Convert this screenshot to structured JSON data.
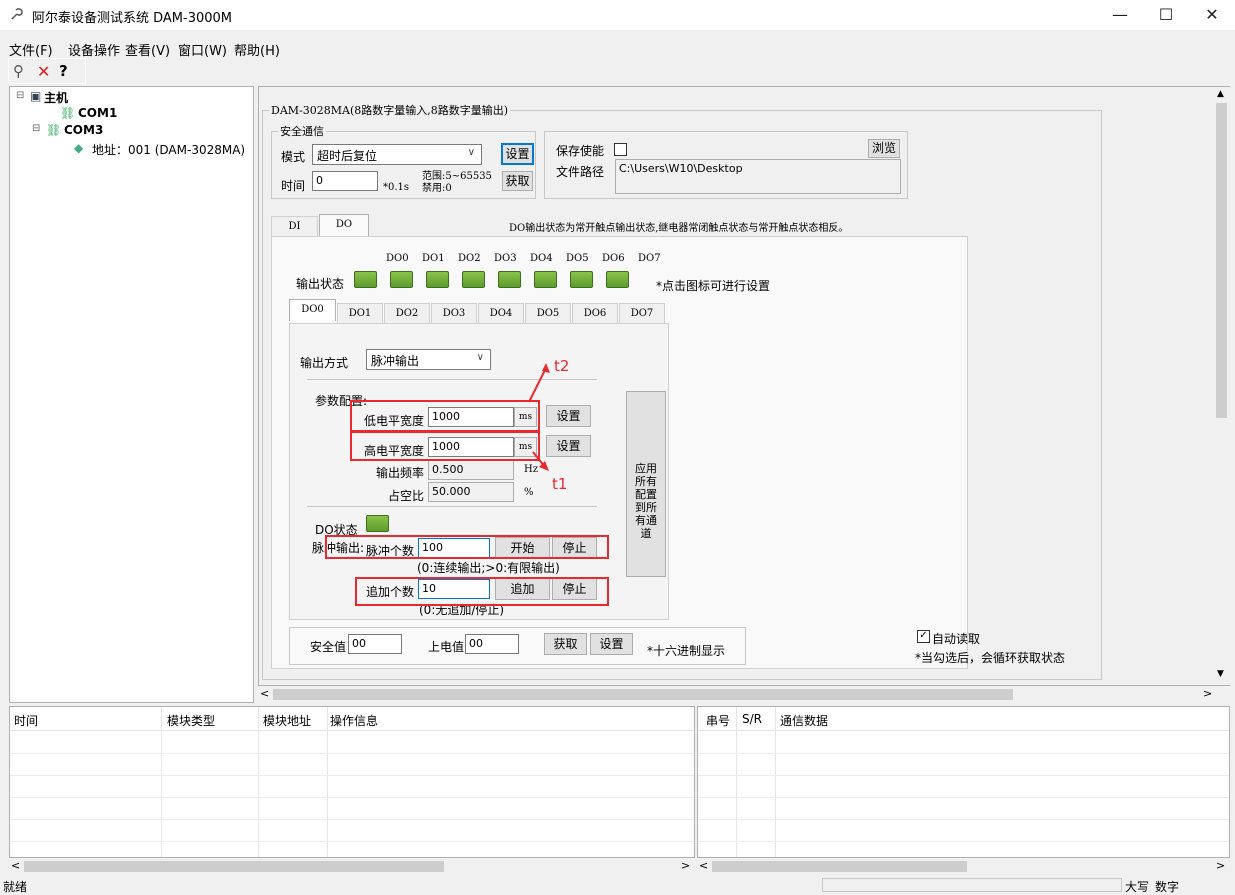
{
  "window": {
    "title": "阿尔泰设备测试系统 DAM-3000M",
    "minimize": "—",
    "maximize": "☐",
    "close": "✕"
  },
  "menu": [
    "文件(F)",
    "设备操作",
    "查看(V)",
    "窗口(W)",
    "帮助(H)"
  ],
  "toolbar": {
    "icons": [
      "search-icon",
      "delete-icon",
      "help-icon"
    ]
  },
  "tree": {
    "root": "主机",
    "com1": "COM1",
    "com3": "COM3",
    "device": "地址：001 (DAM-3028MA)"
  },
  "device_group": "DAM-3028MA(8路数字量输入,8路数字量输出)",
  "security": {
    "title": "安全通信",
    "mode_label": "模式",
    "mode_value": "超时后复位",
    "set_btn": "设置",
    "time_label": "时间",
    "time_value": "0",
    "time_unit": "*0.1s",
    "range_text": "范围:5~65535",
    "disable_text": "禁用:0",
    "get_btn": "获取"
  },
  "save": {
    "enable_label": "保存使能",
    "browse_btn": "浏览",
    "path_label": "文件路径",
    "path_value": "C:\\Users\\W10\\Desktop"
  },
  "main_tabs": [
    "DI",
    "DO"
  ],
  "do_note": "DO输出状态为常开触点输出状态,继电器常闭触点状态与常开触点状态相反。",
  "output": {
    "status_label": "输出状态",
    "channels": [
      "DO0",
      "DO1",
      "DO2",
      "DO3",
      "DO4",
      "DO5",
      "DO6",
      "DO7"
    ],
    "hint": "*点击图标可进行设置"
  },
  "channel_tabs": [
    "DO0",
    "DO1",
    "DO2",
    "DO3",
    "DO4",
    "DO5",
    "DO6",
    "DO7"
  ],
  "config": {
    "mode_label": "输出方式",
    "mode_value": "脉冲输出",
    "param_title": "参数配置:",
    "low_label": "低电平宽度",
    "low_value": "1000",
    "high_label": "高电平宽度",
    "high_value": "1000",
    "unit_ms": "ms",
    "set_btn": "设置",
    "freq_label": "输出频率",
    "freq_value": "0.500",
    "freq_unit": "Hz",
    "duty_label": "占空比",
    "duty_value": "50.000",
    "duty_unit": "%",
    "do_state_label": "DO状态",
    "pulse_out_label": "脉冲输出:",
    "pulse_count_label": "脉冲个数",
    "pulse_count_value": "100",
    "start_btn": "开始",
    "stop_btn": "停止",
    "pulse_note": "(0:连续输出;>0:有限输出)",
    "add_label": "追加个数",
    "add_value": "10",
    "add_btn": "追加",
    "add_stop_btn": "停止",
    "add_note": "(0:无追加/停止)",
    "apply_all_btn": "应用所有配置到所有通道"
  },
  "annotations": {
    "t1": "t1",
    "t2": "t2"
  },
  "safe": {
    "safe_label": "安全值",
    "safe_value": "00",
    "power_label": "上电值",
    "power_value": "00",
    "get_btn": "获取",
    "set_btn": "设置",
    "hex_note": "*十六进制显示"
  },
  "auto_read": {
    "label": "自动读取",
    "note": "*当勾选后，会循环获取状态"
  },
  "log_headers": [
    "时间",
    "模块类型",
    "模块地址",
    "操作信息"
  ],
  "comm_headers": [
    "串号",
    "S/R",
    "通信数据"
  ],
  "status": {
    "ready": "就绪",
    "caps": "大写",
    "num": "数字"
  },
  "colors": {
    "accent": "#0078d7",
    "annotation": "#e8292f",
    "led": "#6aa839"
  }
}
